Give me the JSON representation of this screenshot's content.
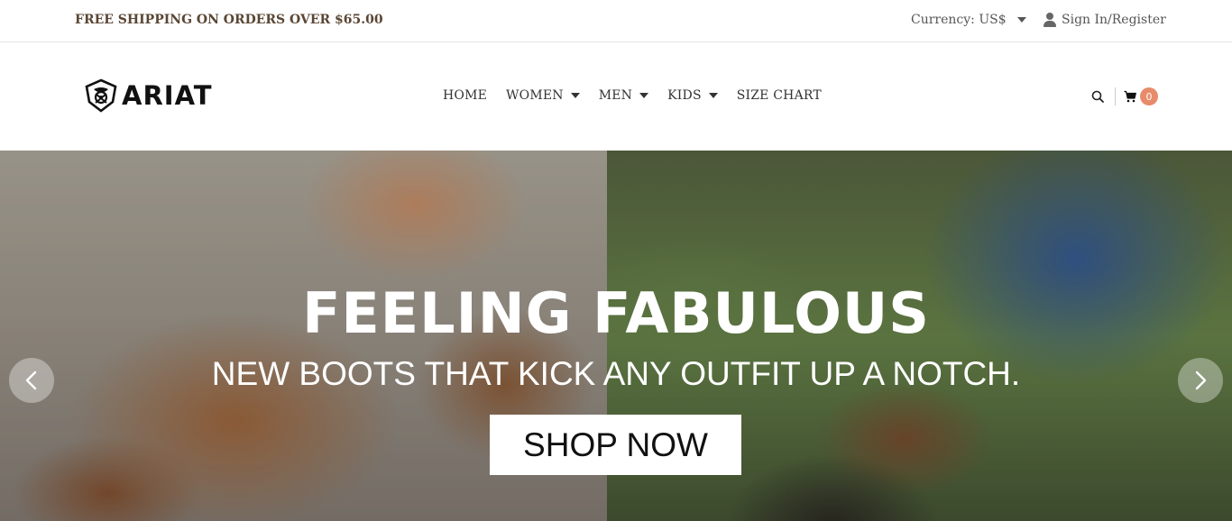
{
  "topbar": {
    "shipping": "FREE SHIPPING ON ORDERS OVER $65.00",
    "currency": "Currency: US$",
    "signin": "Sign In/Register"
  },
  "header": {
    "logo_text": "ARIAT",
    "nav": [
      {
        "label": "HOME",
        "dropdown": false
      },
      {
        "label": "WOMEN",
        "dropdown": true
      },
      {
        "label": "MEN",
        "dropdown": true
      },
      {
        "label": "KIDS",
        "dropdown": true
      },
      {
        "label": "SIZE CHART",
        "dropdown": false
      }
    ],
    "cart_count": "0"
  },
  "hero": {
    "title": "FEELING FABULOUS",
    "subtitle": "NEW BOOTS THAT KICK ANY OUTFIT UP A NOTCH.",
    "cta": "SHOP NOW"
  },
  "colors": {
    "accent_badge": "#e88b6b",
    "shipping_text": "#5a4634"
  }
}
